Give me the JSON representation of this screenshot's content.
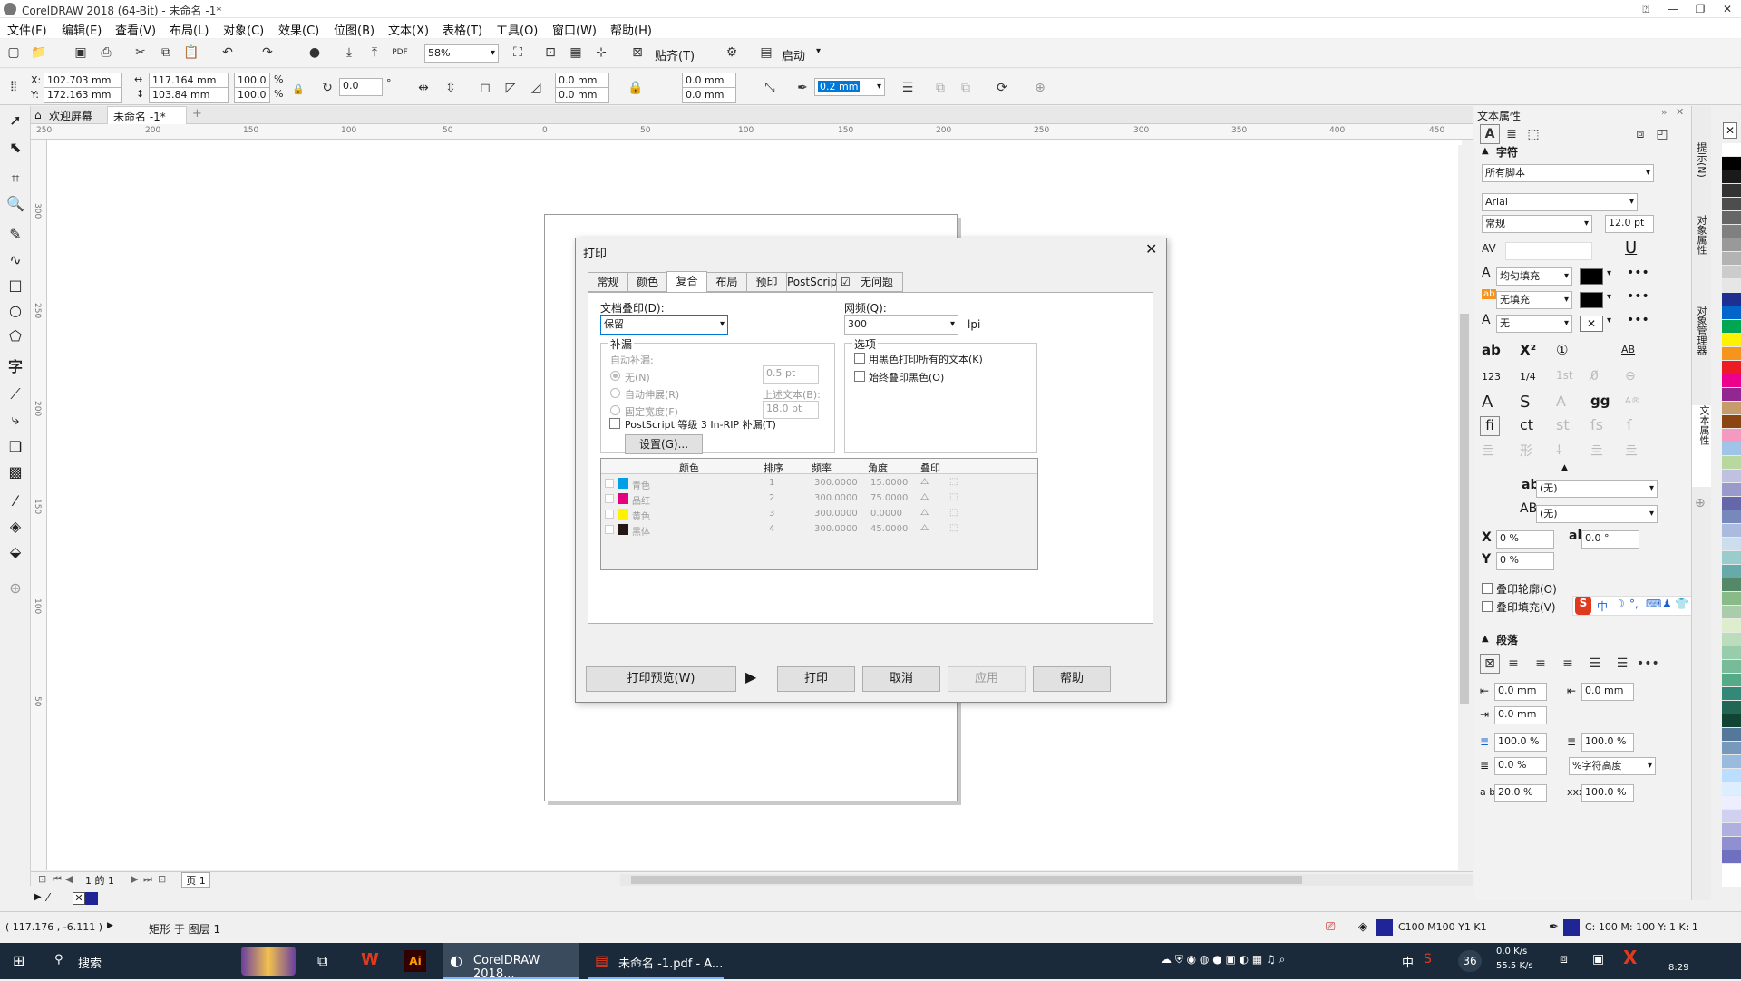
{
  "window": {
    "title": "CorelDRAW 2018 (64-Bit) - 未命名 -1*",
    "minimize": "—",
    "restore": "❐",
    "close": "✕"
  },
  "menu": [
    "文件(F)",
    "编辑(E)",
    "查看(V)",
    "布局(L)",
    "对象(C)",
    "效果(C)",
    "位图(B)",
    "文本(X)",
    "表格(T)",
    "工具(O)",
    "窗口(W)",
    "帮助(H)"
  ],
  "toolbar1": {
    "zoom": "58%",
    "snap_label": "贴齐(T)",
    "launch_label": "启动"
  },
  "toolbar2": {
    "x": "102.703 mm",
    "y": "172.163 mm",
    "w": "117.164 mm",
    "h": "103.84 mm",
    "scale_x": "100.0",
    "scale_y": "100.0",
    "pct": "%",
    "angle": "0.0",
    "deg": "°",
    "corner1": "0.0 mm",
    "corner2": "0.0 mm",
    "corner3": "0.0 mm",
    "corner4": "0.0 mm",
    "outline_width": "0.2 mm"
  },
  "doc_tabs": {
    "welcome": "欢迎屏幕",
    "doc": "未命名 -1*",
    "add": "+"
  },
  "ruler": {
    "h_ticks": [
      "250",
      "200",
      "150",
      "100",
      "50",
      "0",
      "50",
      "100",
      "150",
      "200",
      "250",
      "300",
      "350",
      "400",
      "450"
    ],
    "v_ticks": [
      "300",
      "250",
      "200",
      "150",
      "100",
      "50"
    ]
  },
  "dialog": {
    "title": "打印",
    "tabs": [
      "常规",
      "颜色",
      "复合",
      "布局",
      "预印",
      "PostScript",
      "无问题"
    ],
    "active_tab": "复合",
    "doc_overprint_label": "文档叠印(D):",
    "doc_overprint_value": "保留",
    "screen_label": "网频(Q):",
    "screen_value": "300",
    "screen_unit": "lpi",
    "trap_group": "补漏",
    "auto_trap": "自动补漏:",
    "opt_none": "无(N)",
    "opt_auto_spread": "自动伸展(R)",
    "opt_fixed_width": "固定宽度(F)",
    "trap_value1": "0.5 pt",
    "above_text": "上述文本(B):",
    "trap_value2": "18.0 pt",
    "ps_trap": "PostScript 等级 3 In-RIP 补漏(T)",
    "settings_btn": "设置(G)...",
    "options_group": "选项",
    "opt_black_text": "用黑色打印所有的文本(K)",
    "opt_always_black": "始终叠印黑色(O)",
    "table_headers": [
      "颜色",
      "排序",
      "频率",
      "角度",
      "叠印"
    ],
    "rows": [
      {
        "name": "青色",
        "color": "#00a0e9",
        "order": "1",
        "freq": "300.0000",
        "angle": "15.0000"
      },
      {
        "name": "品红",
        "color": "#e4007f",
        "order": "2",
        "freq": "300.0000",
        "angle": "75.0000"
      },
      {
        "name": "黄色",
        "color": "#fff100",
        "order": "3",
        "freq": "300.0000",
        "angle": "0.0000"
      },
      {
        "name": "黑体",
        "color": "#231815",
        "order": "4",
        "freq": "300.0000",
        "angle": "45.0000"
      }
    ],
    "btn_preview": "打印预览(W)",
    "btn_print": "打印",
    "btn_cancel": "取消",
    "btn_apply": "应用",
    "btn_help": "帮助",
    "close": "✕"
  },
  "docker": {
    "title": "文本属性",
    "char_section": "字符",
    "script": "所有脚本",
    "font": "Arial",
    "style": "常规",
    "size": "12.0 pt",
    "fill1": "均匀填充",
    "fill2": "无填充",
    "outline": "无",
    "none1": "(无)",
    "none2": "(无)",
    "x_offset": "0 %",
    "y_offset": "0 %",
    "rotation": "0.0 °",
    "overprint_outline": "叠印轮廓(O)",
    "overprint_fill": "叠印填充(V)",
    "para_section": "段落",
    "indent1": "0.0 mm",
    "indent2": "0.0 mm",
    "indent3": "0.0 mm",
    "spacing1": "100.0 %",
    "spacing2": "100.0 %",
    "spacing3": "0.0 %",
    "spacing_unit": "%字符高度",
    "spacing4": "20.0 %",
    "spacing5": "100.0 %",
    "ime": "中"
  },
  "side_tabs": [
    "提示(N)",
    "对象属性",
    "对象管理器",
    "文本属性"
  ],
  "palette": [
    "#ffffff",
    "#000000",
    "#1a1a1a",
    "#333333",
    "#4d4d4d",
    "#666666",
    "#808080",
    "#999999",
    "#b3b3b3",
    "#cccccc",
    "#e6e6e6",
    "#1f2f8f",
    "#0066cc",
    "#00a651",
    "#fff200",
    "#f7941d",
    "#ed1c24",
    "#ec008c",
    "#92278f",
    "#c69c6d",
    "#8b4513",
    "#f49ac1",
    "#a0c4e8",
    "#b8d8a0",
    "#c0c0e0",
    "#9999cc",
    "#6666aa",
    "#7788bb",
    "#aabbdd",
    "#ccddee",
    "#99cccc",
    "#66aaaa",
    "#558866",
    "#88bb88",
    "#aaccaa",
    "#ddeecc",
    "#bbddbb",
    "#99ccaa",
    "#77bb99",
    "#55aa88",
    "#338877",
    "#226655",
    "#114433",
    "#557799",
    "#7799bb",
    "#99bbdd",
    "#bbddff",
    "#ddeeff",
    "#eeeeff",
    "#d0d0f0",
    "#b0b0e0",
    "#9090d0",
    "#7070c0"
  ],
  "page_nav": {
    "page_info": "1 的 1",
    "page_tab": "页 1"
  },
  "status": {
    "coords": "( 117.176 , -6.111 )",
    "object": "矩形 于 图层 1",
    "fill_info": "C100 M100 Y1 K1",
    "outline_info": "C: 100 M: 100 Y: 1 K: 1",
    "fill_color": "#1f2496"
  },
  "taskbar": {
    "search": "搜索",
    "app1": "CorelDRAW 2018...",
    "app2": "未命名 -1.pdf - A...",
    "net_up": "0.0 K/s",
    "net_down": "55.5 K/s",
    "temp": "36",
    "ime": "中",
    "time": "8:29"
  }
}
